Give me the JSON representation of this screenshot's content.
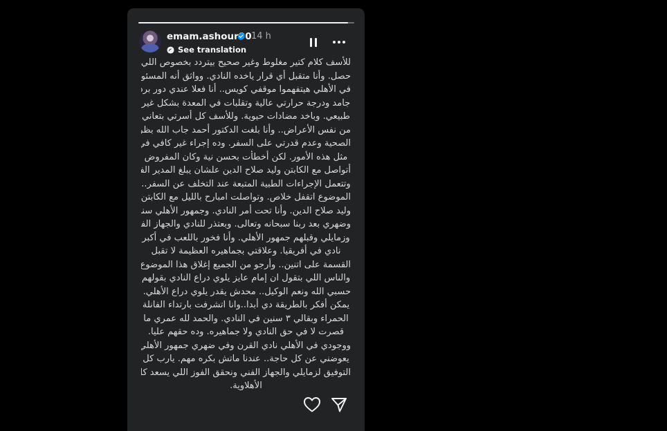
{
  "story": {
    "username": "emam.ashour90",
    "time": "14 h",
    "translation_label": "See translation",
    "progress_fraction": 0.97,
    "lines": [
      "للأسف كلام كتير مغلوط وغير صحيح بيتردد بخصوص اللي",
      "حصل. وأنا متقبل أي قرار ياخده النادي. وواثق أنه المسئولين",
      "في الأهلي هيتفهموا موقفي كويس.. أنا فعلا عندي دور برد",
      "جامد ودرجة حرارتي عالية وتقلبات في المعدة بشكل غير",
      "طبيعي. وباخد مضادات حيوية. وللأسف كل أسرتي بتعاني",
      "من نفس الأعراض.. وأنا بلغت الدكتور أحمد جاب الله بظروفي",
      "الصحية وعدم قدرتي على السفر. وده إجراء غير كافي في",
      "مثل هذه الأمور. لكن أخطأت بحسن نية وكان المفروض",
      "أتواصل مع الكابتن وليد صلاح الدين علشان يبلغ المدير الفني",
      "وتتعمل الإجراءات الطبية المتبعة عند التخلف عن السفر..",
      "الموضوع اتقفل خلاص. وتواصلت امبارح بالليل مع الكابتن",
      "وليد صلاح الدين. وأنا تحت أمر النادي. وجمهور الأهلي سندي",
      "وضهري بعد ربنا سبحانه وتعالى. وبعتذر للنادي والجهاز الفني",
      "وزمايلي وقبلهم جمهور الأهلي. وأنا فخور باللعب في أكبر",
      "نادي في أفريقيا. وعلاقتي بجماهيره العظيمة لا تقبل",
      "القسمة على اتنين.. وأرجو من الجميع إغلاق هذا الموضوع..",
      "والناس اللي بتقول ان إمام عايز يلوي دراع النادي بقولهم",
      "حسبي الله ونعم الوكيل.. محدش يقدر يلوي دراع الأهلي. ولا",
      "يمكن أفكر بالطريقة دي أبدا..وانا اتشرفت بارتداء الفانلة",
      "الحمراء وبقالي ٣ سنين في النادي. والحمد لله عمري ما",
      "قصرت لا في حق النادي ولا جماهيره. وده حقهم عليا.",
      "ووجودي في الأهلي نادي القرن وفي ضهري جمهور الأهلي",
      "يعوضني عن كل حاجة.. عندنا ماتش بكره مهم. يارب كل",
      "التوفيق لزمايلي والجهاز الفني ونحقق الفوز اللي يسعد كل",
      "الأهلاوية."
    ]
  },
  "colors": {
    "page_bg": "#000000",
    "card_bg": "#222325",
    "text": "#d9d9d9",
    "muted": "#a8a8a8",
    "verified": "#0095f6"
  },
  "icons": [
    "verified-badge-icon",
    "globe-icon",
    "pause-icon",
    "more-icon",
    "heart-icon",
    "send-icon"
  ]
}
